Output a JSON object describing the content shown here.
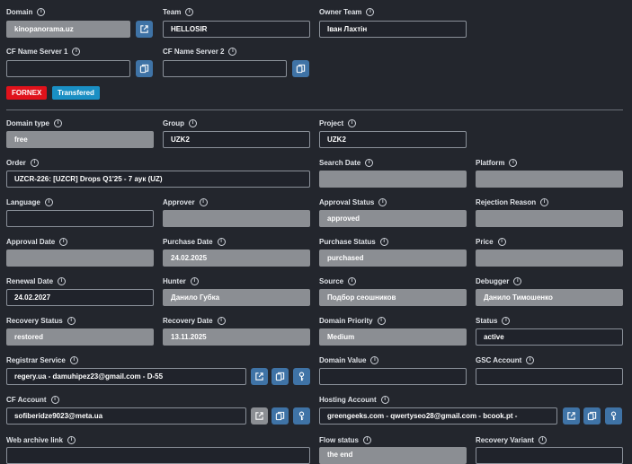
{
  "top": {
    "domain_label": "Domain",
    "domain_value": "kinopanorama.uz",
    "team_label": "Team",
    "team_value": "HELLOSIR",
    "owner_team_label": "Owner Team",
    "owner_team_value": "Іван Лахтін",
    "cf_ns1_label": "CF Name Server 1",
    "cf_ns1_value": "",
    "cf_ns2_label": "CF Name Server 2",
    "cf_ns2_value": "",
    "badge_fornex": "FORNEX",
    "badge_transfered": "Transfered"
  },
  "fields": {
    "domain_type_label": "Domain type",
    "domain_type_value": "free",
    "group_label": "Group",
    "group_value": "UZK2",
    "project_label": "Project",
    "project_value": "UZK2",
    "order_label": "Order",
    "order_value": "UZCR-226: [UZCR] Drops Q1'25 - 7 аук (UZ)",
    "search_date_label": "Search Date",
    "search_date_value": "",
    "platform_label": "Platform",
    "platform_value": "",
    "language_label": "Language",
    "language_value": "",
    "approver_label": "Approver",
    "approver_value": "",
    "approval_status_label": "Approval Status",
    "approval_status_value": "approved",
    "rejection_reason_label": "Rejection Reason",
    "rejection_reason_value": "",
    "approval_date_label": "Approval Date",
    "approval_date_value": "",
    "purchase_date_label": "Purchase Date",
    "purchase_date_value": "24.02.2025",
    "purchase_status_label": "Purchase Status",
    "purchase_status_value": "purchased",
    "price_label": "Price",
    "price_value": "",
    "renewal_date_label": "Renewal Date",
    "renewal_date_value": "24.02.2027",
    "hunter_label": "Hunter",
    "hunter_value": "Данило Губка",
    "source_label": "Source",
    "source_value": "Подбор сеошников",
    "debugger_label": "Debugger",
    "debugger_value": "Данило Тимошенко",
    "recovery_status_label": "Recovery Status",
    "recovery_status_value": "restored",
    "recovery_date_label": "Recovery Date",
    "recovery_date_value": "13.11.2025",
    "domain_priority_label": "Domain Priority",
    "domain_priority_value": "Medium",
    "status_label": "Status",
    "status_value": "active",
    "registrar_service_label": "Registrar Service",
    "registrar_service_value": "regery.ua - damuhipez23@gmail.com - D-55",
    "domain_value_label": "Domain Value",
    "domain_value_value": "",
    "gsc_account_label": "GSC Account",
    "gsc_account_value": "",
    "cf_account_label": "CF Account",
    "cf_account_value": "sofiberidze9023@meta.ua",
    "hosting_account_label": "Hosting Account",
    "hosting_account_value": "greengeeks.com - qwertyseo28@gmail.com - bcook.pt -",
    "web_archive_label": "Web archive link",
    "web_archive_value": "",
    "flow_status_label": "Flow status",
    "flow_status_value": "the end",
    "recovery_variant_label": "Recovery Variant",
    "recovery_variant_value": ""
  },
  "icons": {
    "info": "info-icon",
    "external": "external-link-icon",
    "copy": "copy-icon",
    "key": "key-icon"
  },
  "colors": {
    "background": "#23262d",
    "field_dark": "#20232b",
    "field_gray": "#8b8e93",
    "button_blue": "#3f73a6",
    "badge_red": "#e0121b",
    "badge_blue": "#1a8fc4"
  }
}
